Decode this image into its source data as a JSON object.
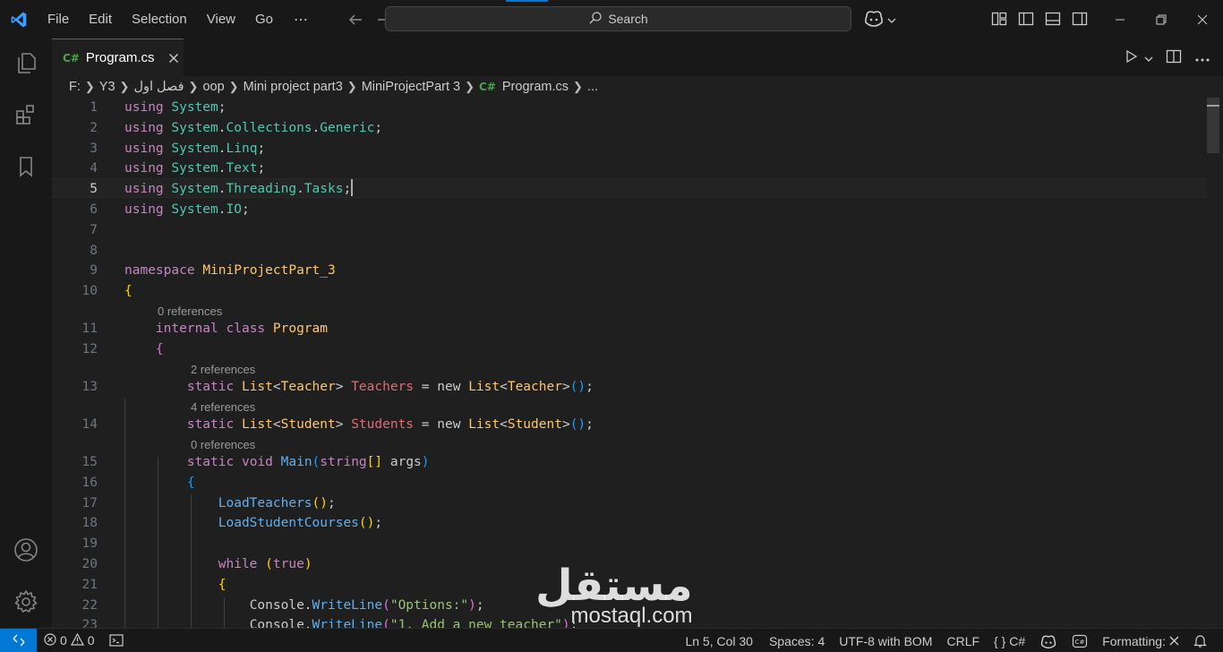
{
  "menu": {
    "items": [
      "File",
      "Edit",
      "Selection",
      "View",
      "Go"
    ],
    "more": "⋯"
  },
  "search": {
    "placeholder": "Search"
  },
  "tab": {
    "label": "Program.cs",
    "lang_badge": "C#"
  },
  "breadcrumb": {
    "items": [
      "F:",
      "Y3",
      "فصل اول",
      "oop",
      "Mini project part3",
      "MiniProjectPart 3",
      "Program.cs",
      "..."
    ],
    "lang_badge": "C#"
  },
  "editor": {
    "lenses": {
      "class_program": "0 references",
      "teachers": "2 references",
      "students": "4 references",
      "main": "0 references"
    },
    "line_numbers": [
      "1",
      "2",
      "3",
      "4",
      "5",
      "6",
      "7",
      "8",
      "9",
      "10",
      "11",
      "12",
      "13",
      "14",
      "15",
      "16",
      "17",
      "18",
      "19",
      "20",
      "21",
      "22",
      "23"
    ],
    "current_line": 5
  },
  "statusbar": {
    "errors": "0",
    "warnings": "0",
    "position": "Ln 5, Col 30",
    "spaces": "Spaces: 4",
    "encoding": "UTF-8 with BOM",
    "eol": "CRLF",
    "language": "C#",
    "formatting": "Formatting:"
  },
  "watermark": {
    "brand": "مستقل",
    "url": "mostaql.com"
  },
  "colors": {
    "accent": "#0078d4",
    "background": "#1f1f1f",
    "chrome": "#181818"
  }
}
